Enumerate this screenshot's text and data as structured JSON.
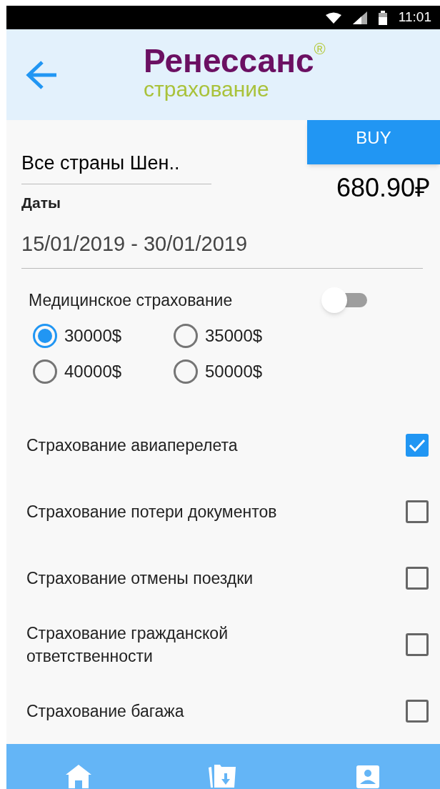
{
  "status_bar": {
    "time": "11:01"
  },
  "header": {
    "logo_top": "Ренессанс",
    "logo_mark": "®",
    "logo_bottom": "страхование"
  },
  "buy_button": "BUY",
  "country_field": {
    "value": "Все страны Шен.."
  },
  "price": "680.90₽",
  "dates": {
    "label": "Даты",
    "value": "15/01/2019 - 30/01/2019"
  },
  "medical": {
    "label": "Медицинское страхование",
    "on": false,
    "options": [
      {
        "label": "30000$",
        "selected": true
      },
      {
        "label": "35000$",
        "selected": false
      },
      {
        "label": "40000$",
        "selected": false
      },
      {
        "label": "50000$",
        "selected": false
      }
    ]
  },
  "options": [
    {
      "label": "Страхование авиаперелета",
      "checked": true
    },
    {
      "label": "Страхование потери документов",
      "checked": false
    },
    {
      "label": "Страхование отмены поездки",
      "checked": false
    },
    {
      "label": "Страхование гражданской ответственности",
      "checked": false
    },
    {
      "label": "Страхование багажа",
      "checked": false
    }
  ],
  "bottom_nav": [
    {
      "kind": "home"
    },
    {
      "kind": "folder"
    },
    {
      "kind": "profile"
    }
  ]
}
